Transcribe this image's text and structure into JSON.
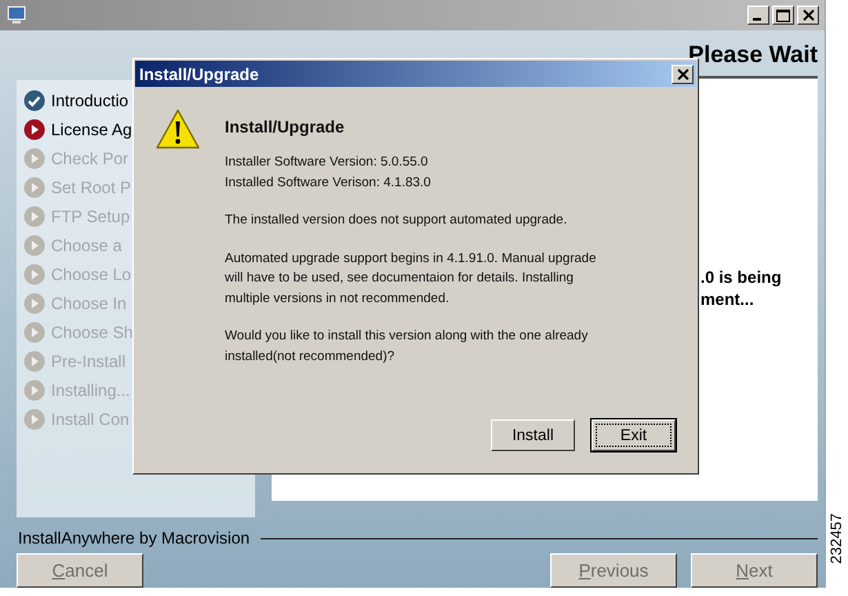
{
  "header": {
    "title": "Please Wait"
  },
  "steps": [
    {
      "label": "Introductio",
      "done": true,
      "current": false
    },
    {
      "label": "License Ag",
      "done": false,
      "current": true
    },
    {
      "label": "Check Por",
      "done": false,
      "current": false
    },
    {
      "label": "Set Root P",
      "done": false,
      "current": false
    },
    {
      "label": "FTP Setup",
      "done": false,
      "current": false
    },
    {
      "label": "Choose a",
      "done": false,
      "current": false
    },
    {
      "label": "Choose Lo",
      "done": false,
      "current": false
    },
    {
      "label": "Choose In",
      "done": false,
      "current": false
    },
    {
      "label": "Choose Sh",
      "done": false,
      "current": false
    },
    {
      "label": "Pre-Install",
      "done": false,
      "current": false
    },
    {
      "label": "Installing...",
      "done": false,
      "current": false
    },
    {
      "label": "Install Con",
      "done": false,
      "current": false
    }
  ],
  "content": {
    "lines": [
      ".0 is being",
      "ment..."
    ]
  },
  "footer": {
    "brand": "InstallAnywhere by Macrovision",
    "buttons": [
      {
        "label": "Cancel",
        "disabled": true
      },
      {
        "label": "Previous",
        "disabled": true
      },
      {
        "label": "Next",
        "disabled": true
      }
    ]
  },
  "dialog": {
    "title": "Install/Upgrade",
    "heading": "Install/Upgrade",
    "paragraphs": [
      [
        "Installer Software Version: 5.0.55.0",
        "Installed Software Verison: 4.1.83.0"
      ],
      [
        "The installed version does not support automated upgrade."
      ],
      [
        "Automated upgrade support begins in 4.1.91.0.  Manual upgrade",
        "will have to be used, see documentaion for details.  Installing",
        "multiple versions in not recommended."
      ],
      [
        "Would you like to install this version along with the one already",
        "installed(not recommended)?"
      ]
    ],
    "buttons": [
      {
        "label": "Install",
        "focused": false
      },
      {
        "label": "Exit",
        "focused": true
      }
    ]
  },
  "figure_id": "232457"
}
